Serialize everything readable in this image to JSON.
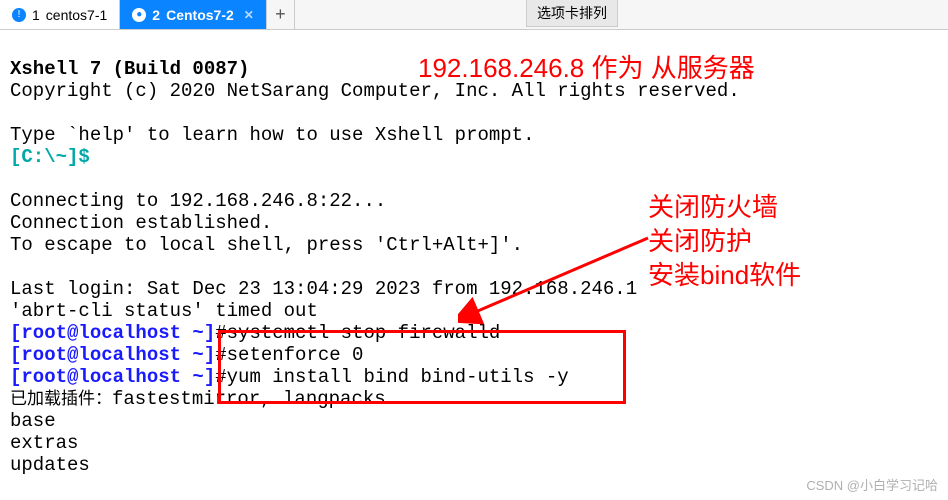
{
  "tabs": {
    "items": [
      {
        "num": "1",
        "label": "centos7-1",
        "active": false
      },
      {
        "num": "2",
        "label": "Centos7-2",
        "active": true
      }
    ],
    "add": "+"
  },
  "gray_label": "选项卡排列",
  "terminal": {
    "header1": "Xshell 7 (Build 0087)",
    "header2": "Copyright (c) 2020 NetSarang Computer, Inc. All rights reserved.",
    "help": "Type `help' to learn how to use Xshell prompt.",
    "prompt_local": "[C:\\~]$",
    "connect1": "Connecting to 192.168.246.8:22...",
    "connect2": "Connection established.",
    "connect3": "To escape to local shell, press 'Ctrl+Alt+]'.",
    "lastlogin": "Last login: Sat Dec 23 13:04:29 2023 from 192.168.246.1",
    "abrt": "'abrt-cli status' timed out",
    "root_prompt": "[root@localhost ~]",
    "hash": "#",
    "cmd1": "systemctl stop firewalld",
    "cmd2": "setenforce 0",
    "cmd3": "yum install bind bind-utils -y",
    "plugins_label": "已加载插件：",
    "plugins_val": "fastestmirror, langpacks",
    "repo1": "base",
    "repo2": "extras",
    "repo3": "updates"
  },
  "annotations": {
    "top": "192.168.246.8 作为 从服务器",
    "side1": "关闭防火墙",
    "side2": "关闭防护",
    "side3": "安装bind软件"
  },
  "watermark": "CSDN @小白学习记哈"
}
